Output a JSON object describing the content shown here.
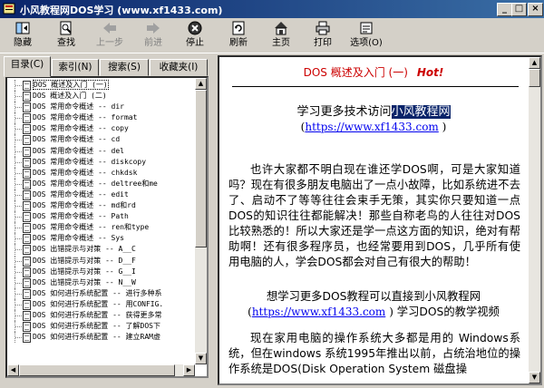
{
  "window": {
    "title": "小风教程网DOS学习 (www.xf1433.com)"
  },
  "toolbar": [
    {
      "id": "hide",
      "label": "隐藏",
      "icon": "hide-icon",
      "enabled": true
    },
    {
      "id": "find",
      "label": "查找",
      "icon": "find-icon",
      "enabled": true
    },
    {
      "id": "back",
      "label": "上一步",
      "icon": "back-arrow-icon",
      "enabled": false
    },
    {
      "id": "forward",
      "label": "前进",
      "icon": "forward-arrow-icon",
      "enabled": false
    },
    {
      "id": "stop",
      "label": "停止",
      "icon": "stop-icon",
      "enabled": true
    },
    {
      "id": "refresh",
      "label": "刷新",
      "icon": "refresh-icon",
      "enabled": true
    },
    {
      "id": "home",
      "label": "主页",
      "icon": "home-icon",
      "enabled": true
    },
    {
      "id": "print",
      "label": "打印",
      "icon": "print-icon",
      "enabled": true
    },
    {
      "id": "options",
      "label": "选项(O)",
      "icon": "options-icon",
      "enabled": true
    }
  ],
  "tabs": [
    {
      "label": "目录(C)",
      "active": true
    },
    {
      "label": "索引(N)",
      "active": false
    },
    {
      "label": "搜索(S)",
      "active": false
    },
    {
      "label": "收藏夹(I)",
      "active": false
    }
  ],
  "tree": [
    {
      "text": "DOS 概述及入门 (一)",
      "selected": true
    },
    {
      "text": "DOS 概述及入门 (二)"
    },
    {
      "text": "DOS 常用命令概述 -- dir"
    },
    {
      "text": "DOS 常用命令概述 -- format"
    },
    {
      "text": "DOS 常用命令概述 -- copy"
    },
    {
      "text": "DOS 常用命令概述 -- cd"
    },
    {
      "text": "DOS 常用命令概述 -- del"
    },
    {
      "text": "DOS 常用命令概述 -- diskcopy"
    },
    {
      "text": "DOS 常用命令概述 -- chkdsk"
    },
    {
      "text": "DOS 常用命令概述 -- deltree和me"
    },
    {
      "text": "DOS 常用命令概述 -- edit"
    },
    {
      "text": "DOS 常用命令概述 -- md和rd"
    },
    {
      "text": "DOS 常用命令概述 -- Path"
    },
    {
      "text": "DOS 常用命令概述 -- ren和type"
    },
    {
      "text": "DOS 常用命令概述 -- Sys"
    },
    {
      "text": "DOS 出错提示与对策 -- A__C"
    },
    {
      "text": "DOS 出错提示与对策 -- D__F"
    },
    {
      "text": "DOS 出错提示与对策 -- G__I"
    },
    {
      "text": "DOS 出错提示与对策 -- N__W"
    },
    {
      "text": "DOS 如何进行系统配置 -- 进行多种系"
    },
    {
      "text": "DOS 如何进行系统配置 -- 用CONFIG."
    },
    {
      "text": "DOS 如何进行系统配置 -- 获得更多常"
    },
    {
      "text": "DOS 如何进行系统配置 -- 了解DOS下"
    },
    {
      "text": "DOS 如何进行系统配置 -- 建立RAM虚"
    }
  ],
  "content": {
    "heading": "DOS 概述及入门 (一)",
    "hot": "Hot!",
    "visit_prefix": "学习更多技术访问",
    "visit_highlight": "小风教程网",
    "url": "https://www.xf1433.com",
    "paren_open": "(",
    "paren_close": ")",
    "para1": "也许大家都不明白现在谁还学DOS啊，可是大家知道吗？现在有很多朋友电脑出了一点小故障，比如系统进不去了、启动不了等等往往会束手无策，其实你只要知道一点DOS的知识往往都能解决！那些自称老鸟的人往往对DOS比较熟悉的！所以大家还是学一点这方面的知识，绝对有帮助啊！还有很多程序员，也经常要用到DOS，几乎所有使用电脑的人，学会DOS都会对自己有很大的帮助！",
    "para2_line1": "想学习更多DOS教程可以直接到小风教程网",
    "para2_suffix": "学习DOS的教学视频",
    "para3": "现在家用电脑的操作系统大多都是用的 Windows系统，但在windows 系统1995年推出以前，占统治地位的操作系统是DOS(Disk Operation System 磁盘操"
  }
}
